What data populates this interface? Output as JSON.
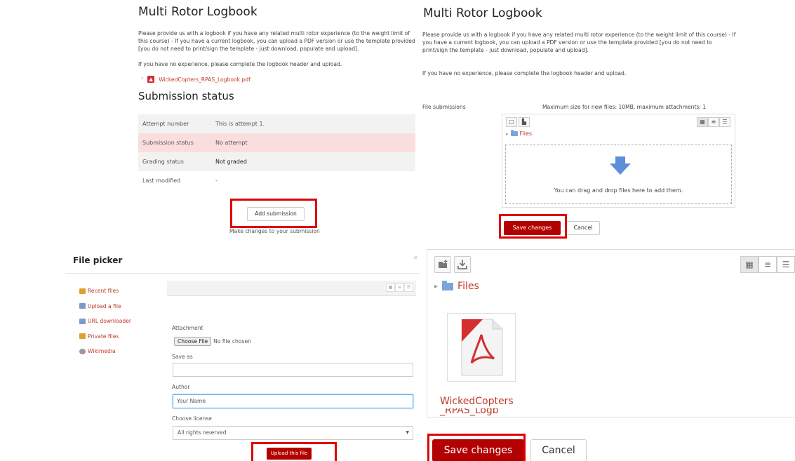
{
  "panel1": {
    "title": "Multi Rotor Logbook",
    "paragraph": "Please provide us with a logbook if you have any related multi rotor experience (to the weight limit of this course) - If you have a current logbook, you can upload a PDF version or use the template provided [you do not need to print/sign the template - just download, populate and upload].",
    "paragraph2": "If you have no experience, please complete the logbook header and upload.",
    "pdf_link": "WickedCopters_RPAS_Logbook.pdf",
    "submission_heading": "Submission status",
    "rows": [
      {
        "label": "Attempt number",
        "value": "This is attempt 1."
      },
      {
        "label": "Submission status",
        "value": "No attempt"
      },
      {
        "label": "Grading status",
        "value": "Not graded"
      },
      {
        "label": "Last modified",
        "value": "-"
      }
    ],
    "add_submission": "Add submission",
    "help_text": "Make changes to your submission"
  },
  "panel2": {
    "title": "Multi Rotor Logbook",
    "paragraph": "Please provide us with a logbook if you have any related multi rotor experience (to the weight limit of this course) - If you have a current logbook, you can upload a PDF version or use the template provided [you do not need to print/sign the template - just download, populate and upload].",
    "paragraph2": "If you have no experience, please complete the logbook header and upload.",
    "file_submissions_label": "File submissions",
    "max_size": "Maximum size for new files: 10MB, maximum attachments: 1",
    "folder": "Files",
    "drop_text": "You can drag and drop files here to add them.",
    "save": "Save changes",
    "cancel": "Cancel"
  },
  "panel3": {
    "title": "File picker",
    "close": "×",
    "repos": [
      {
        "label": "Recent files",
        "icon": "folder-icon",
        "color": "#e0a030"
      },
      {
        "label": "Upload a file",
        "icon": "upload-icon",
        "color": "#7a9cc6"
      },
      {
        "label": "URL downloader",
        "icon": "url-icon",
        "color": "#7a9cc6"
      },
      {
        "label": "Private files",
        "icon": "folder-icon",
        "color": "#e0a030"
      },
      {
        "label": "Wikimedia",
        "icon": "wikimedia-icon",
        "color": "#999999"
      }
    ],
    "attachment_label": "Attachment",
    "choose_file": "Choose File",
    "no_file": "No file chosen",
    "save_as_label": "Save as",
    "save_as_value": "",
    "author_label": "Author",
    "author_value": "Your Name",
    "license_label": "Choose license",
    "license_value": "All rights reserved",
    "upload": "Upload this file"
  },
  "panel4": {
    "folder": "Files",
    "file_name": "WickedCopters",
    "file_name_cont": "_RPAS_Logb",
    "save": "Save changes",
    "cancel": "Cancel"
  },
  "colors": {
    "accent": "#b30000",
    "highlight": "#e00000",
    "link": "#c0392b",
    "warning_row": "#fadede"
  }
}
